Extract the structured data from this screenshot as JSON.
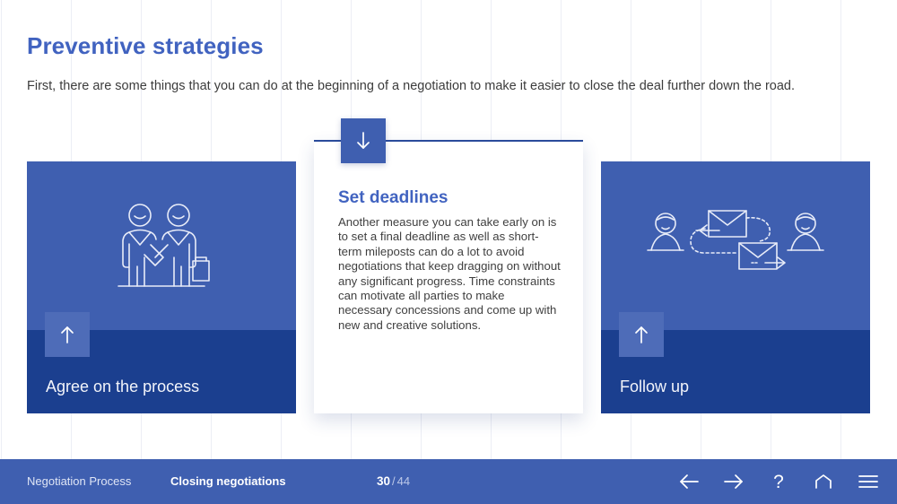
{
  "slide": {
    "title": "Preventive strategies",
    "intro": "First, there are some things that you can do at the beginning of a negotiation to make it easier to close the deal further down the road.",
    "title_color": "#4163c0",
    "card_blue": "#3f5fb0",
    "card_band_navy": "#1b3f8f",
    "badge_blue_light": "#4e6cb8"
  },
  "cards": [
    {
      "id": "agree-on-the-process",
      "label": "Agree on the process",
      "state": "collapsed",
      "toggle_icon": "arrow-up-icon",
      "illustration_icon": "handshake-people-icon"
    },
    {
      "id": "set-deadlines",
      "label": "Set deadlines",
      "state": "expanded",
      "toggle_icon": "arrow-down-icon",
      "body": "Another measure you can take early on is to set a final deadline as well as short-term mileposts can do a lot to avoid negotiations that keep dragging on without any significant progress. Time constraints can motivate all parties to make necessary concessions and come up with new and creative solutions."
    },
    {
      "id": "follow-up",
      "label": "Follow up",
      "state": "collapsed",
      "toggle_icon": "arrow-up-icon",
      "illustration_icon": "email-exchange-icon"
    }
  ],
  "footer": {
    "course": "Negotiation Process",
    "section": "Closing negotiations",
    "page_current": "30",
    "page_separator": "/",
    "page_total": "44",
    "nav": [
      {
        "name": "previous-slide-button",
        "icon": "arrow-left-icon",
        "glyph": "←"
      },
      {
        "name": "next-slide-button",
        "icon": "arrow-right-icon",
        "glyph": "→"
      },
      {
        "name": "help-button",
        "icon": "question-mark-icon",
        "glyph": "?"
      },
      {
        "name": "home-button",
        "icon": "home-icon",
        "glyph": "⌂"
      },
      {
        "name": "menu-button",
        "icon": "hamburger-menu-icon",
        "glyph": "☰"
      }
    ]
  }
}
